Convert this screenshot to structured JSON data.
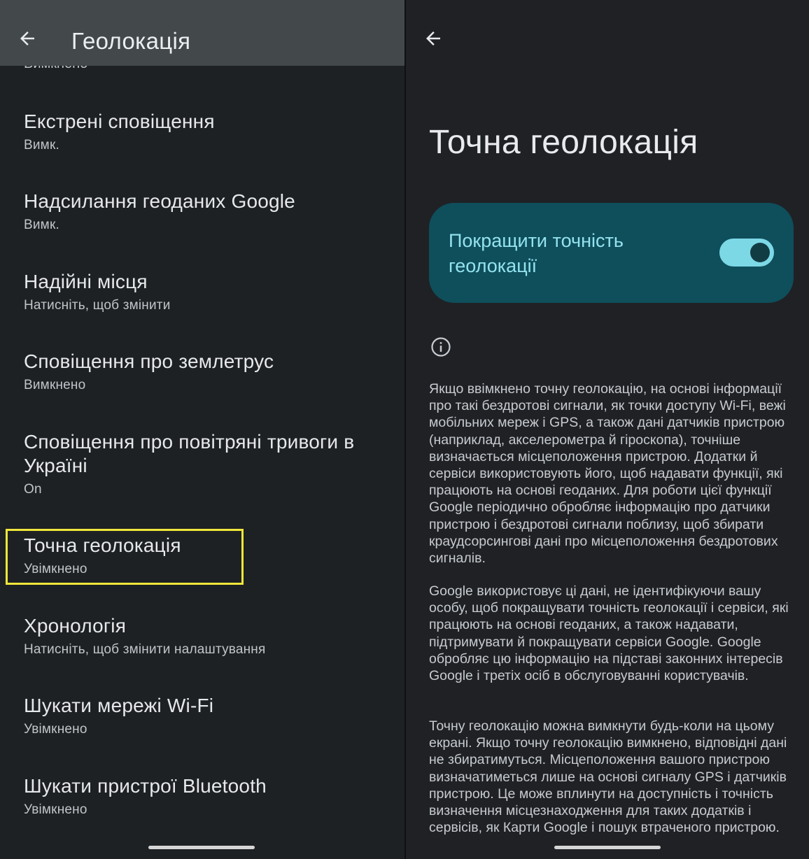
{
  "left": {
    "appbar": {
      "title": "Геолокація"
    },
    "cut_item_sub": "Вимкнено",
    "items": [
      {
        "title": "Екстрені сповіщення",
        "subtitle": "Вимк."
      },
      {
        "title": "Надсилання геоданих Google",
        "subtitle": "Вимк."
      },
      {
        "title": "Надійні місця",
        "subtitle": "Натисніть, щоб змінити"
      },
      {
        "title": "Сповіщення про землетрус",
        "subtitle": "Вимкнено"
      },
      {
        "title": "Сповіщення про повітряні тривоги в Україні",
        "subtitle": "On"
      },
      {
        "title": "Точна геолокація",
        "subtitle": "Увімкнено"
      },
      {
        "title": "Хронологія",
        "subtitle": "Натисніть, щоб змінити налаштування"
      },
      {
        "title": "Шукати мережі Wi-Fi",
        "subtitle": "Увімкнено"
      },
      {
        "title": "Шукати пристрої Bluetooth",
        "subtitle": "Увімкнено"
      }
    ],
    "highlight_color": "#f0e63a"
  },
  "right": {
    "page_title": "Точна геолокація",
    "toggle": {
      "label": "Покращити точність геолокації",
      "state": "on"
    },
    "paragraphs": [
      "Якщо ввімкнено точну геолокацію, на основі інформації про такі бездротові сигнали, як точки доступу Wi-Fi, вежі мобільних мереж і GPS, а також дані датчиків пристрою (наприклад, акселерометра й гіроскопа), точніше визначається місцеположення пристрою. Додатки й сервіси використовують його, щоб надавати функції, які працюють на основі геода­них. Для роботи цієї функції Google періодично обро­бляє інформацію про датчики пристрою і бездротові сигнали поблизу, щоб збирати краудсорсингові дані про місцеположення бездротових сигналів.",
      "Google використовує ці дані, не ідентифікуючи вашу особу, щоб покращувати точність геолокації і сервіси, які працюють на основі геоданих, а також надавати, підтримувати й покращувати сервіси Google. Google обробляє цю інформацію на підставі законних інтересів Google і третіх осіб в обслуговуванні користувачів.",
      "Точну геолокацію можна вимкнути будь-коли на цьому екрані. Якщо точну геолокацію вимкнено, відповідні дані не збиратимуться. Місцеположення вашого пристрою визначатиметься лише на основі сигналу GPS і датчиків пристрою. Це може вплинути на доступність і точність визначення місцезнаходження для таких додатків і сервісів, як Карти Google і пошук втраченого пристрою."
    ]
  }
}
